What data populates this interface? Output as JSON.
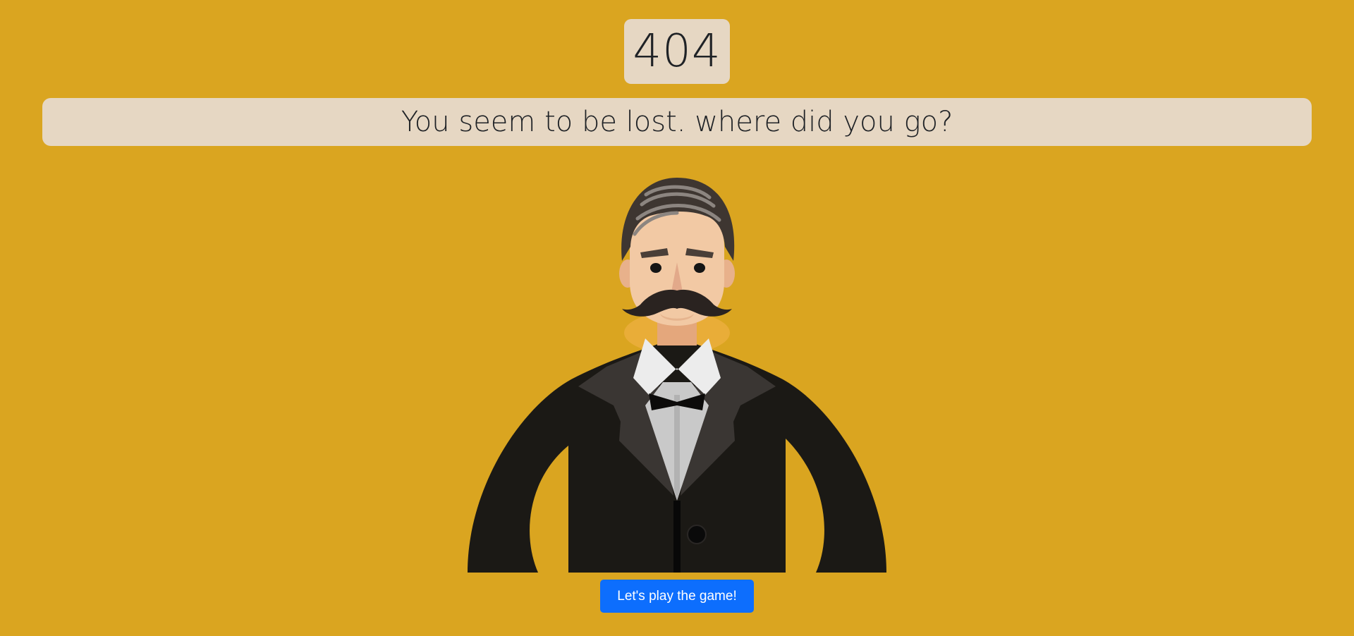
{
  "error": {
    "code": "404",
    "message": "You seem to be lost. where did you go?"
  },
  "illustration": {
    "icon": "mustached-gentleman-in-tuxedo-illustration"
  },
  "actions": {
    "play_label": "Let's play the game!"
  },
  "colors": {
    "background": "#DAA520",
    "panel": "#E6D7C3",
    "text": "#1F2226",
    "button": "#0D6EFD",
    "button_text": "#FFFFFF",
    "suit": "#1B1915",
    "lapel": "#3A3633",
    "skin": "#F2C9A4",
    "hair": "#3E3631"
  }
}
